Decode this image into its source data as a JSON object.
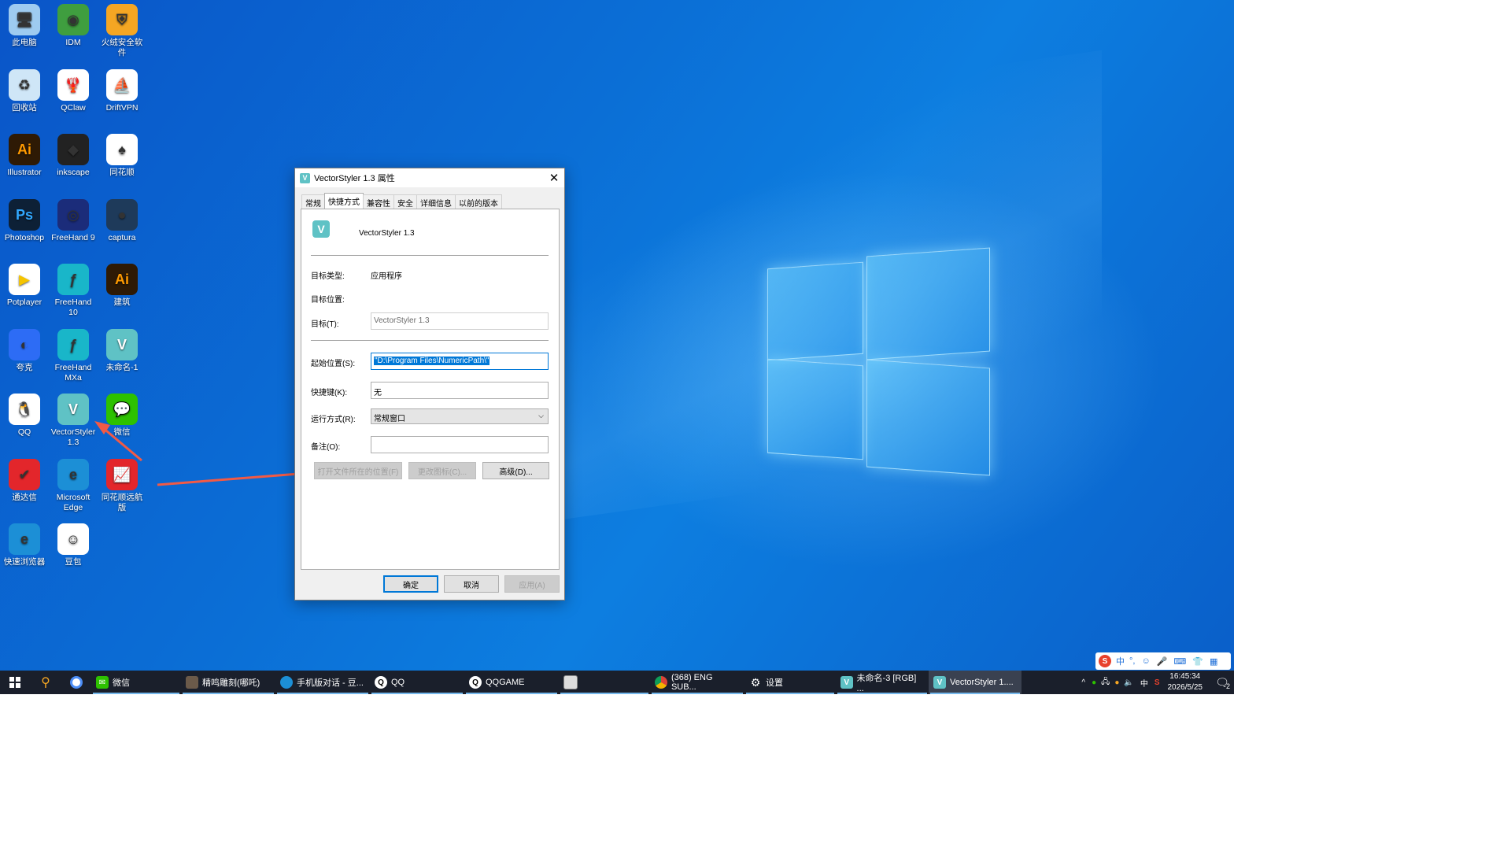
{
  "desktop_icons": [
    {
      "label": "此电脑",
      "icon": "computer-icon",
      "color": "#9ecbf0"
    },
    {
      "label": "IDM",
      "icon": "idm-globe-icon",
      "color": "#3f9e3f"
    },
    {
      "label": "火绒安全软件",
      "icon": "huorong-shield-icon",
      "color": "#f5a623"
    },
    {
      "label": "回收站",
      "icon": "recycle-bin-icon",
      "color": "#cfe6f7"
    },
    {
      "label": "QClaw",
      "icon": "qclaw-icon",
      "color": "#ffffff"
    },
    {
      "label": "DriftVPN",
      "icon": "driftvpn-icon",
      "color": "#ffffff"
    },
    {
      "label": "Illustrator",
      "icon": "illustrator-icon",
      "color": "#2e1a05"
    },
    {
      "label": "inkscape",
      "icon": "inkscape-icon",
      "color": "#222222"
    },
    {
      "label": "同花顺",
      "icon": "tonghuashun-icon",
      "color": "#ffffff"
    },
    {
      "label": "Photoshop",
      "icon": "photoshop-icon",
      "color": "#0d2036"
    },
    {
      "label": "FreeHand 9",
      "icon": "freehand9-icon",
      "color": "#1b2c7a"
    },
    {
      "label": "captura",
      "icon": "captura-icon",
      "color": "#1e3a5a"
    },
    {
      "label": "Potplayer",
      "icon": "potplayer-icon",
      "color": "#ffffff"
    },
    {
      "label": "FreeHand 10",
      "icon": "freehand10-icon",
      "color": "#19b6c9"
    },
    {
      "label": "建筑",
      "icon": "illustrator-icon",
      "color": "#2e1a05"
    },
    {
      "label": "夸克",
      "icon": "quark-icon",
      "color": "#2d6cf5"
    },
    {
      "label": "FreeHand MXa",
      "icon": "freehandmx-icon",
      "color": "#19b6c9"
    },
    {
      "label": "未命名-1",
      "icon": "vectorstyler-icon",
      "color": "#5fc2c5"
    },
    {
      "label": "QQ",
      "icon": "qq-penguin-icon",
      "color": "#ffffff"
    },
    {
      "label": "VectorStyler 1.3",
      "icon": "vectorstyler-icon",
      "color": "#5fc2c5"
    },
    {
      "label": "微信",
      "icon": "wechat-icon",
      "color": "#2dc100"
    },
    {
      "label": "通达信",
      "icon": "tongdaxin-icon",
      "color": "#e3262b"
    },
    {
      "label": "Microsoft Edge",
      "icon": "edge-icon",
      "color": "#1c8fd6"
    },
    {
      "label": "同花顺远航版",
      "icon": "tonghuashun-yuanhang-icon",
      "color": "#e3262b"
    },
    {
      "label": "快速浏览器",
      "icon": "ie-icon",
      "color": "#1c8fd6"
    },
    {
      "label": "豆包",
      "icon": "doubao-icon",
      "color": "#ffffff"
    }
  ],
  "dialog": {
    "title": "VectorStyler 1.3 属性",
    "tabs": [
      "常规",
      "快捷方式",
      "兼容性",
      "安全",
      "详细信息",
      "以前的版本"
    ],
    "active_tab": "快捷方式",
    "app_name": "VectorStyler 1.3",
    "target_type_label": "目标类型:",
    "target_type_value": "应用程序",
    "target_location_label": "目标位置:",
    "target_label": "目标(T):",
    "target_value": "VectorStyler 1.3",
    "start_in_label": "起始位置(S):",
    "start_in_value": "\"D:\\Program Files\\NumericPath\\\"",
    "shortcut_key_label": "快捷键(K):",
    "shortcut_key_value": "无",
    "run_label": "运行方式(R):",
    "run_value": "常规窗口",
    "comment_label": "备注(O):",
    "comment_value": "",
    "open_location_button": "打开文件所在的位置(F)",
    "change_icon_button": "更改图标(C)...",
    "advanced_button": "高级(D)...",
    "ok_button": "确定",
    "cancel_button": "取消",
    "apply_button": "应用(A)"
  },
  "taskbar": {
    "items": [
      {
        "label": "微信",
        "icon": "wechat-icon"
      },
      {
        "label": "精鸣雕刻(哪吒)",
        "icon": "app-thumbnail-icon"
      },
      {
        "label": "手机版对话 - 豆...",
        "icon": "edge-icon"
      },
      {
        "label": "QQ",
        "icon": "qq-penguin-icon"
      },
      {
        "label": "QQGAME",
        "icon": "qq-penguin-icon"
      },
      {
        "label": "",
        "icon": "window-icon"
      },
      {
        "label": "(368) ENG SUB...",
        "icon": "chrome-icon"
      },
      {
        "label": "设置",
        "icon": "gear-icon"
      },
      {
        "label": "未命名-3 [RGB] ...",
        "icon": "vectorstyler-icon"
      },
      {
        "label": "VectorStyler 1....",
        "icon": "vectorstyler-icon"
      }
    ],
    "clock_time": "16:45:34",
    "clock_date": "2026/5/25",
    "ime_lang": "中",
    "notification_count": "2"
  },
  "ime_bar": {
    "lang": "中",
    "punct": "°,"
  }
}
